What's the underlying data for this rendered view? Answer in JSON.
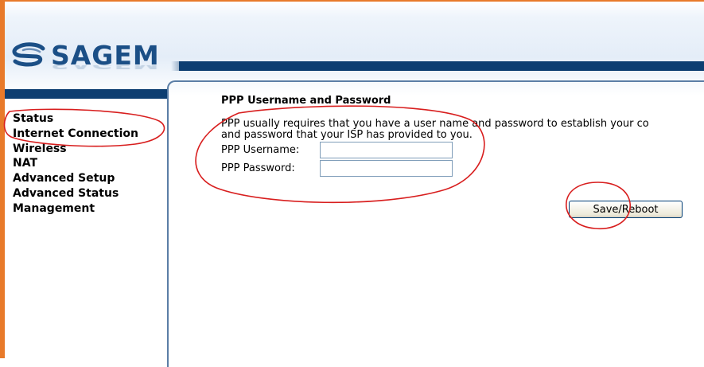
{
  "header": {
    "logo_text": "SAGEM",
    "brand_color": "#1b4f86",
    "bar_color": "#0d3e71",
    "frame_color": "#e87a2a"
  },
  "sidebar": {
    "items": [
      {
        "label": "Status"
      },
      {
        "label": "Internet Connection"
      },
      {
        "label": "Wireless"
      },
      {
        "label": "NAT"
      },
      {
        "label": "Advanced Setup"
      },
      {
        "label": "Advanced Status"
      },
      {
        "label": "Management"
      }
    ]
  },
  "main": {
    "title": "PPP Username and Password",
    "description_line1": "PPP usually requires that you have a user name and password to establish your co",
    "description_line2": "and password that your ISP has provided to you.",
    "username_label": "PPP Username:",
    "username_value": "",
    "password_label": "PPP Password:",
    "password_value": "",
    "save_label": "Save/Reboot"
  },
  "annotations": {
    "color": "#d81e1e",
    "shapes": [
      "sidebar-highlight-ellipse",
      "credentials-highlight-ellipse",
      "save-button-highlight-circle"
    ]
  }
}
